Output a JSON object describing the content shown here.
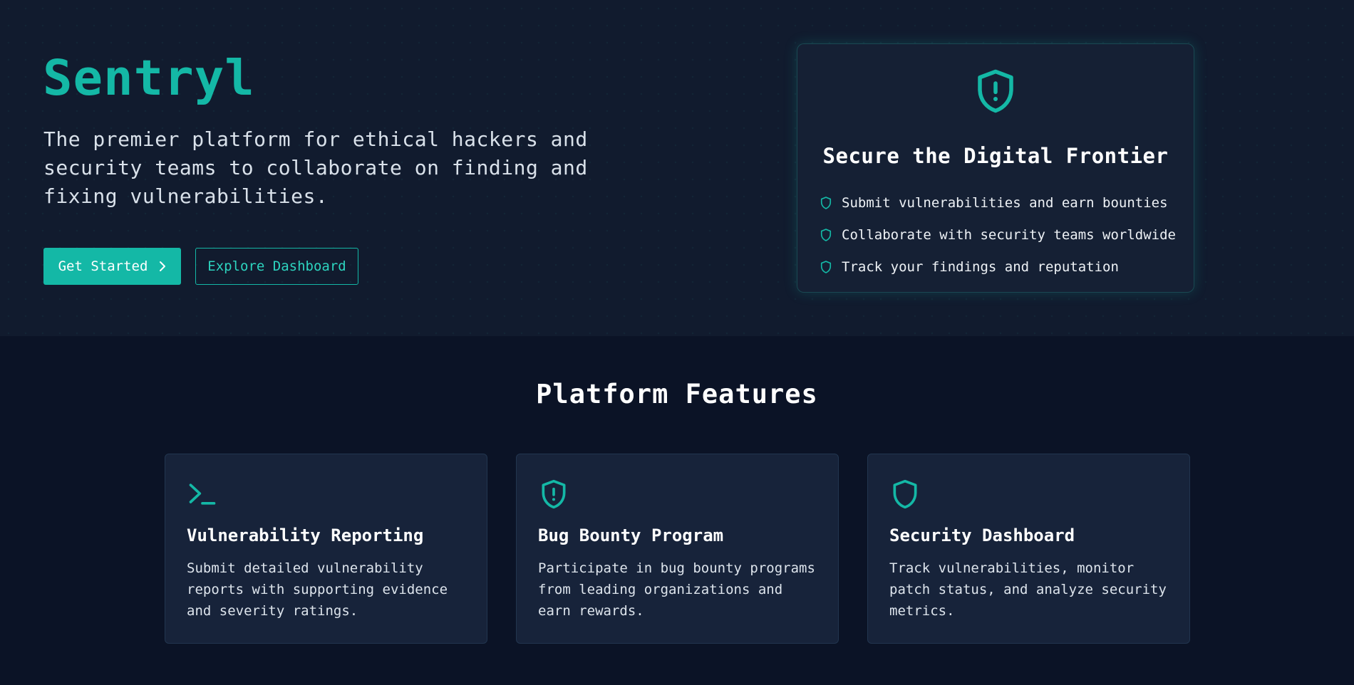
{
  "colors": {
    "accent": "#14b8a6",
    "hero_bg": "#111b2e",
    "page_bg": "#0b1326",
    "card_bg": "#17233a"
  },
  "hero": {
    "brand": "Sentryl",
    "tagline": "The premier platform for ethical hackers and security teams to collaborate on finding and fixing vulnerabilities.",
    "primary_button": "Get Started",
    "primary_button_icon": "chevron-right-icon",
    "secondary_button": "Explore Dashboard"
  },
  "highlight": {
    "icon": "shield-alert-icon",
    "title": "Secure the Digital Frontier",
    "items": [
      {
        "icon": "shield-icon",
        "text": "Submit vulnerabilities and earn bounties"
      },
      {
        "icon": "shield-icon",
        "text": "Collaborate with security teams worldwide"
      },
      {
        "icon": "shield-icon",
        "text": "Track your findings and reputation"
      }
    ]
  },
  "features": {
    "title": "Platform Features",
    "cards": [
      {
        "icon": "terminal-icon",
        "title": "Vulnerability Reporting",
        "description": "Submit detailed vulnerability reports with supporting evidence and severity ratings."
      },
      {
        "icon": "shield-alert-icon",
        "title": "Bug Bounty Program",
        "description": "Participate in bug bounty programs from leading organizations and earn rewards."
      },
      {
        "icon": "shield-icon",
        "title": "Security Dashboard",
        "description": "Track vulnerabilities, monitor patch status, and analyze security metrics."
      }
    ]
  }
}
